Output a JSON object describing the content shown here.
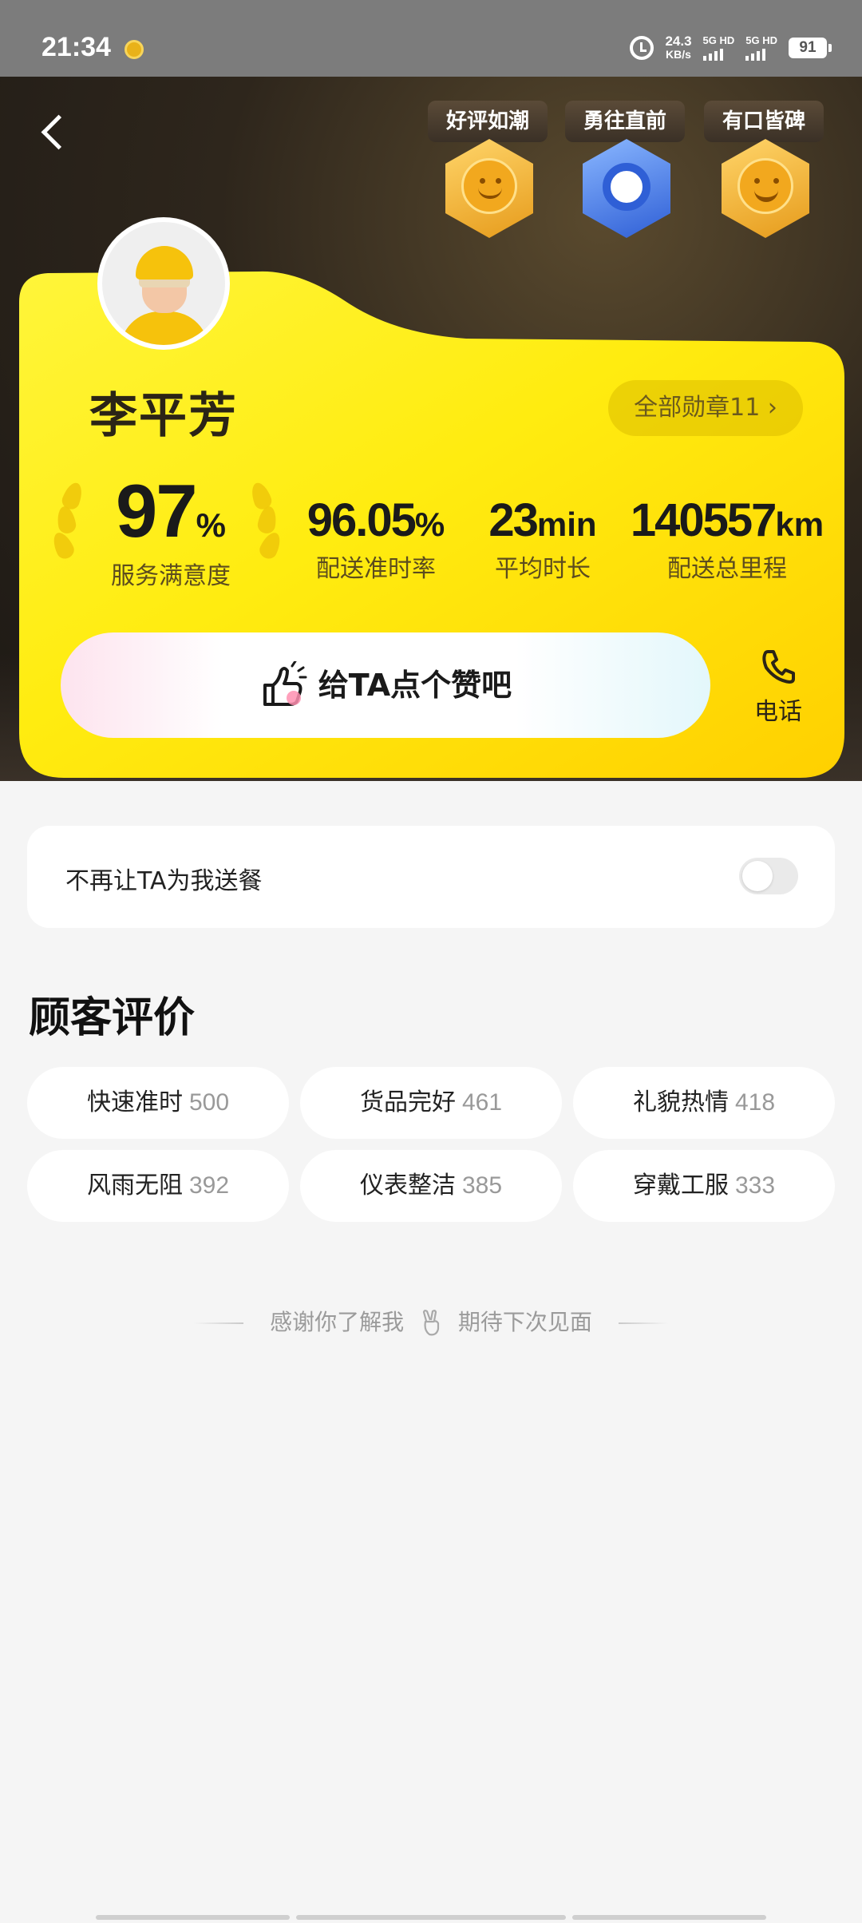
{
  "status_bar": {
    "time": "21:34",
    "speed_value": "24.3",
    "speed_unit": "KB/s",
    "sim1": "5G HD",
    "sim2": "5G HD",
    "battery": "91"
  },
  "rider": {
    "name": "李平芳",
    "badges_button": "全部勋章11 ›"
  },
  "medals": [
    {
      "label": "好评如潮",
      "icon": "smile-medal-icon",
      "color": "#f2a81e"
    },
    {
      "label": "勇往直前",
      "icon": "wheel-medal-icon",
      "color": "#2f5fd6"
    },
    {
      "label": "有口皆碑",
      "icon": "laugh-medal-icon",
      "color": "#f2a81e"
    }
  ],
  "stats": {
    "satisfaction": {
      "value": "97",
      "unit": "%",
      "label": "服务满意度"
    },
    "on_time": {
      "value": "96.05",
      "unit": "%",
      "label": "配送准时率"
    },
    "avg_time": {
      "value": "23",
      "unit": "min",
      "label": "平均时长"
    },
    "distance": {
      "value": "140557",
      "unit": "km",
      "label": "配送总里程"
    }
  },
  "like_button": "给TA点个赞吧",
  "phone_button": "电话",
  "block_setting": {
    "label": "不再让TA为我送餐",
    "enabled": false
  },
  "reviews": {
    "title": "顾客评价",
    "tags": [
      {
        "name": "快速准时",
        "count": "500"
      },
      {
        "name": "货品完好",
        "count": "461"
      },
      {
        "name": "礼貌热情",
        "count": "418"
      },
      {
        "name": "风雨无阻",
        "count": "392"
      },
      {
        "name": "仪表整洁",
        "count": "385"
      },
      {
        "name": "穿戴工服",
        "count": "333"
      }
    ]
  },
  "footer": {
    "left_text": "感谢你了解我",
    "right_text": "期待下次见面"
  },
  "colors": {
    "card_yellow": "#ffe600",
    "card_yellow_dark": "#ffd400",
    "hero_dark": "#2e261c",
    "page_bg": "#f5f5f5"
  }
}
